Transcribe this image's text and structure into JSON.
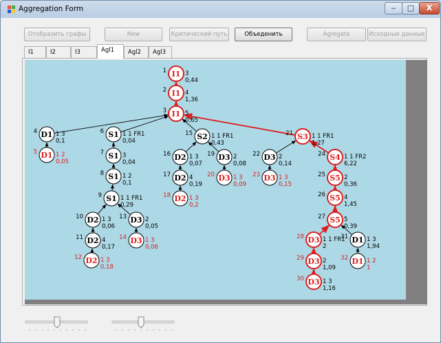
{
  "window": {
    "title": "Aggregation Form",
    "buttons": {
      "minimize": "‒",
      "maximize": "□",
      "close": "X"
    }
  },
  "toolbar": [
    {
      "label": "Отобразить графы",
      "enabled": false
    },
    {
      "label": "New",
      "enabled": false
    },
    {
      "label": "Критический путь",
      "enabled": false
    },
    {
      "label": "Объеденить",
      "enabled": true
    },
    {
      "label": "Agregate",
      "enabled": false
    },
    {
      "label": "Исходные данные",
      "enabled": false
    }
  ],
  "tabs": [
    {
      "label": "I1",
      "active": false
    },
    {
      "label": "I2",
      "active": false
    },
    {
      "label": "I3",
      "active": false
    },
    {
      "label": "Agl1",
      "active": true
    },
    {
      "label": "Agl2",
      "active": false
    },
    {
      "label": "Agl3",
      "active": false
    }
  ],
  "colors": {
    "canvas_bg": "#add8e6",
    "critical": "#dc1e1e",
    "normal": "#000000",
    "scrollbar": "#808080"
  },
  "graph": {
    "nodes": [
      {
        "id": "n1",
        "index": "1",
        "label": "I1",
        "tag": "3",
        "value": "0,44",
        "critical": true
      },
      {
        "id": "n2",
        "index": "2",
        "label": "I1",
        "tag": "4",
        "value": "1,36",
        "critical": true
      },
      {
        "id": "n3",
        "index": "3",
        "label": "I1",
        "tag": "5",
        "value": "0,65",
        "critical": true
      },
      {
        "id": "n4",
        "index": "4",
        "label": "D1",
        "tag": "1 3",
        "value": "0,1",
        "critical": false
      },
      {
        "id": "n5",
        "index": "5",
        "label": "D1",
        "tag": "1 2",
        "value": "0,05",
        "critical": false,
        "red": true
      },
      {
        "id": "n6",
        "index": "6",
        "label": "S1",
        "tag": "1 1 FR1",
        "value": "0,04",
        "critical": false
      },
      {
        "id": "n7",
        "index": "7",
        "label": "S1",
        "tag": "3",
        "value": "0,04",
        "critical": false
      },
      {
        "id": "n8",
        "index": "8",
        "label": "S1",
        "tag": "1 2",
        "value": "0,1",
        "critical": false
      },
      {
        "id": "n9",
        "index": "9",
        "label": "S1",
        "tag": "1 1 FR1",
        "value": "0,29",
        "critical": false
      },
      {
        "id": "n10",
        "index": "10",
        "label": "D2",
        "tag": "1 3",
        "value": "0,06",
        "critical": false
      },
      {
        "id": "n11",
        "index": "11",
        "label": "D2",
        "tag": "4",
        "value": "0,17",
        "critical": false
      },
      {
        "id": "n12",
        "index": "12",
        "label": "D2",
        "tag": "1 3",
        "value": "0,18",
        "critical": false,
        "red": true
      },
      {
        "id": "n13",
        "index": "13",
        "label": "D3",
        "tag": "2",
        "value": "0,05",
        "critical": false
      },
      {
        "id": "n14",
        "index": "14",
        "label": "D3",
        "tag": "1 3",
        "value": "0,06",
        "critical": false,
        "red": true
      },
      {
        "id": "n15",
        "index": "15",
        "label": "S2",
        "tag": "1 1 FR1",
        "value": "0,43",
        "critical": false
      },
      {
        "id": "n16",
        "index": "16",
        "label": "D2",
        "tag": "1 3",
        "value": "0,07",
        "critical": false
      },
      {
        "id": "n17",
        "index": "17",
        "label": "D2",
        "tag": "4",
        "value": "0,19",
        "critical": false
      },
      {
        "id": "n18",
        "index": "18",
        "label": "D2",
        "tag": "1 3",
        "value": "0,2",
        "critical": false,
        "red": true
      },
      {
        "id": "n19",
        "index": "19",
        "label": "D3",
        "tag": "2",
        "value": "0,08",
        "critical": false
      },
      {
        "id": "n20",
        "index": "20",
        "label": "D3",
        "tag": "1 3",
        "value": "0,09",
        "critical": false,
        "red": true
      },
      {
        "id": "n21",
        "index": "21",
        "label": "S3",
        "tag": "1 1 FR1",
        "value": "1,27",
        "critical": true
      },
      {
        "id": "n22",
        "index": "22",
        "label": "D3",
        "tag": "2",
        "value": "0,14",
        "critical": false
      },
      {
        "id": "n23",
        "index": "23",
        "label": "D3",
        "tag": "1 3",
        "value": "0,15",
        "critical": false,
        "red": true
      },
      {
        "id": "n24",
        "index": "24",
        "label": "S4",
        "tag": "1 1 FR2",
        "value": "6,22",
        "critical": true
      },
      {
        "id": "n25",
        "index": "25",
        "label": "S5",
        "tag": "2",
        "value": "0,36",
        "critical": true
      },
      {
        "id": "n26",
        "index": "26",
        "label": "S5",
        "tag": "4",
        "value": "1,45",
        "critical": true
      },
      {
        "id": "n27",
        "index": "27",
        "label": "S5",
        "tag": "5",
        "value": "0,39",
        "critical": true
      },
      {
        "id": "n28",
        "index": "28",
        "label": "D3",
        "tag": "1 1 FR1",
        "value": "2",
        "critical": true
      },
      {
        "id": "n29",
        "index": "29",
        "label": "D3",
        "tag": "2",
        "value": "1,09",
        "critical": true
      },
      {
        "id": "n30",
        "index": "30",
        "label": "D3",
        "tag": "1 3",
        "value": "1,16",
        "critical": true
      },
      {
        "id": "n31",
        "index": "31",
        "label": "D1",
        "tag": "1 3",
        "value": "1,94",
        "critical": false
      },
      {
        "id": "n32",
        "index": "32",
        "label": "D1",
        "tag": "1 2",
        "value": "1",
        "critical": false,
        "red": true
      }
    ],
    "edges": [
      {
        "from": "n2",
        "to": "n1",
        "critical": true
      },
      {
        "from": "n3",
        "to": "n2",
        "critical": true
      },
      {
        "from": "n4",
        "to": "n3",
        "critical": false
      },
      {
        "from": "n6",
        "to": "n3",
        "critical": false
      },
      {
        "from": "n15",
        "to": "n3",
        "critical": false
      },
      {
        "from": "n21",
        "to": "n3",
        "critical": true
      },
      {
        "from": "n5",
        "to": "n4",
        "critical": false
      },
      {
        "from": "n7",
        "to": "n6",
        "critical": false
      },
      {
        "from": "n8",
        "to": "n7",
        "critical": false
      },
      {
        "from": "n9",
        "to": "n8",
        "critical": false
      },
      {
        "from": "n10",
        "to": "n9",
        "critical": false
      },
      {
        "from": "n13",
        "to": "n9",
        "critical": false
      },
      {
        "from": "n11",
        "to": "n10",
        "critical": false
      },
      {
        "from": "n12",
        "to": "n11",
        "critical": false
      },
      {
        "from": "n14",
        "to": "n13",
        "critical": false
      },
      {
        "from": "n16",
        "to": "n15",
        "critical": false
      },
      {
        "from": "n19",
        "to": "n15",
        "critical": false
      },
      {
        "from": "n17",
        "to": "n16",
        "critical": false
      },
      {
        "from": "n18",
        "to": "n17",
        "critical": false
      },
      {
        "from": "n20",
        "to": "n19",
        "critical": false
      },
      {
        "from": "n22",
        "to": "n21",
        "critical": false
      },
      {
        "from": "n24",
        "to": "n21",
        "critical": true
      },
      {
        "from": "n23",
        "to": "n22",
        "critical": false
      },
      {
        "from": "n25",
        "to": "n24",
        "critical": true
      },
      {
        "from": "n26",
        "to": "n25",
        "critical": true
      },
      {
        "from": "n27",
        "to": "n26",
        "critical": true
      },
      {
        "from": "n28",
        "to": "n27",
        "critical": true
      },
      {
        "from": "n31",
        "to": "n27",
        "critical": false
      },
      {
        "from": "n29",
        "to": "n28",
        "critical": true
      },
      {
        "from": "n30",
        "to": "n29",
        "critical": true
      },
      {
        "from": "n32",
        "to": "n31",
        "critical": false
      }
    ]
  },
  "sliders": [
    {
      "value": 0.5
    },
    {
      "value": 0.5
    }
  ]
}
